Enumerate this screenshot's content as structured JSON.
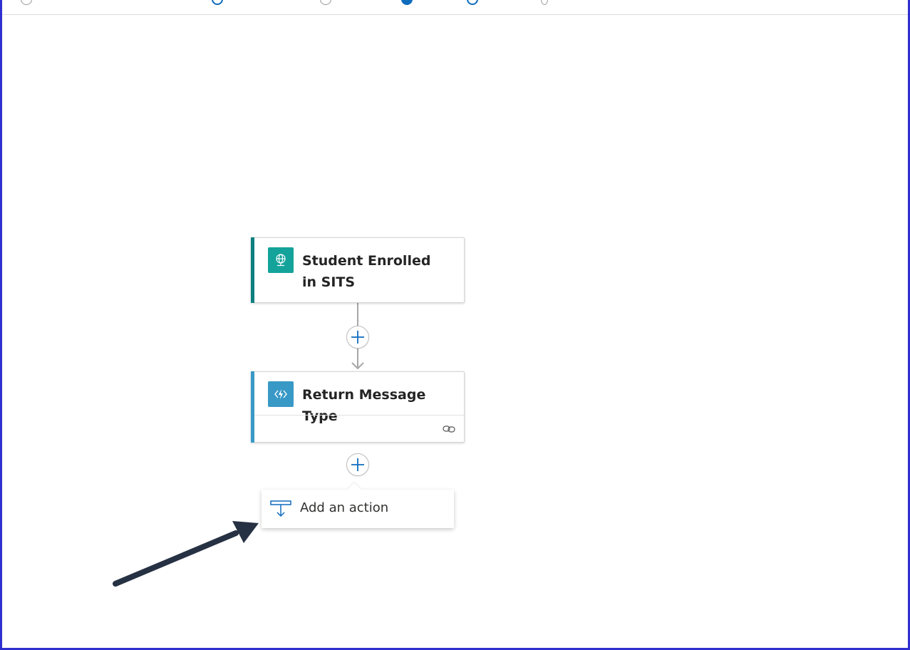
{
  "workflow": {
    "steps": [
      {
        "title": "Student Enrolled in SITS",
        "icon": "globe-network-icon",
        "accent_color": "#0f7f7f",
        "icon_bg": "#14a39a"
      },
      {
        "title": "Return Message Type",
        "icon": "azure-function-icon",
        "accent_color": "#3999c6",
        "icon_bg": "#3999c6"
      }
    ],
    "connector_color": "#a6a6a6",
    "plus_color": "#0f6cbd"
  },
  "popup": {
    "label": "Add an action",
    "icon": "add-action-icon"
  },
  "annotation": {
    "arrow_color": "#263143"
  },
  "frame": {
    "border_color": "#2f2fd0"
  }
}
